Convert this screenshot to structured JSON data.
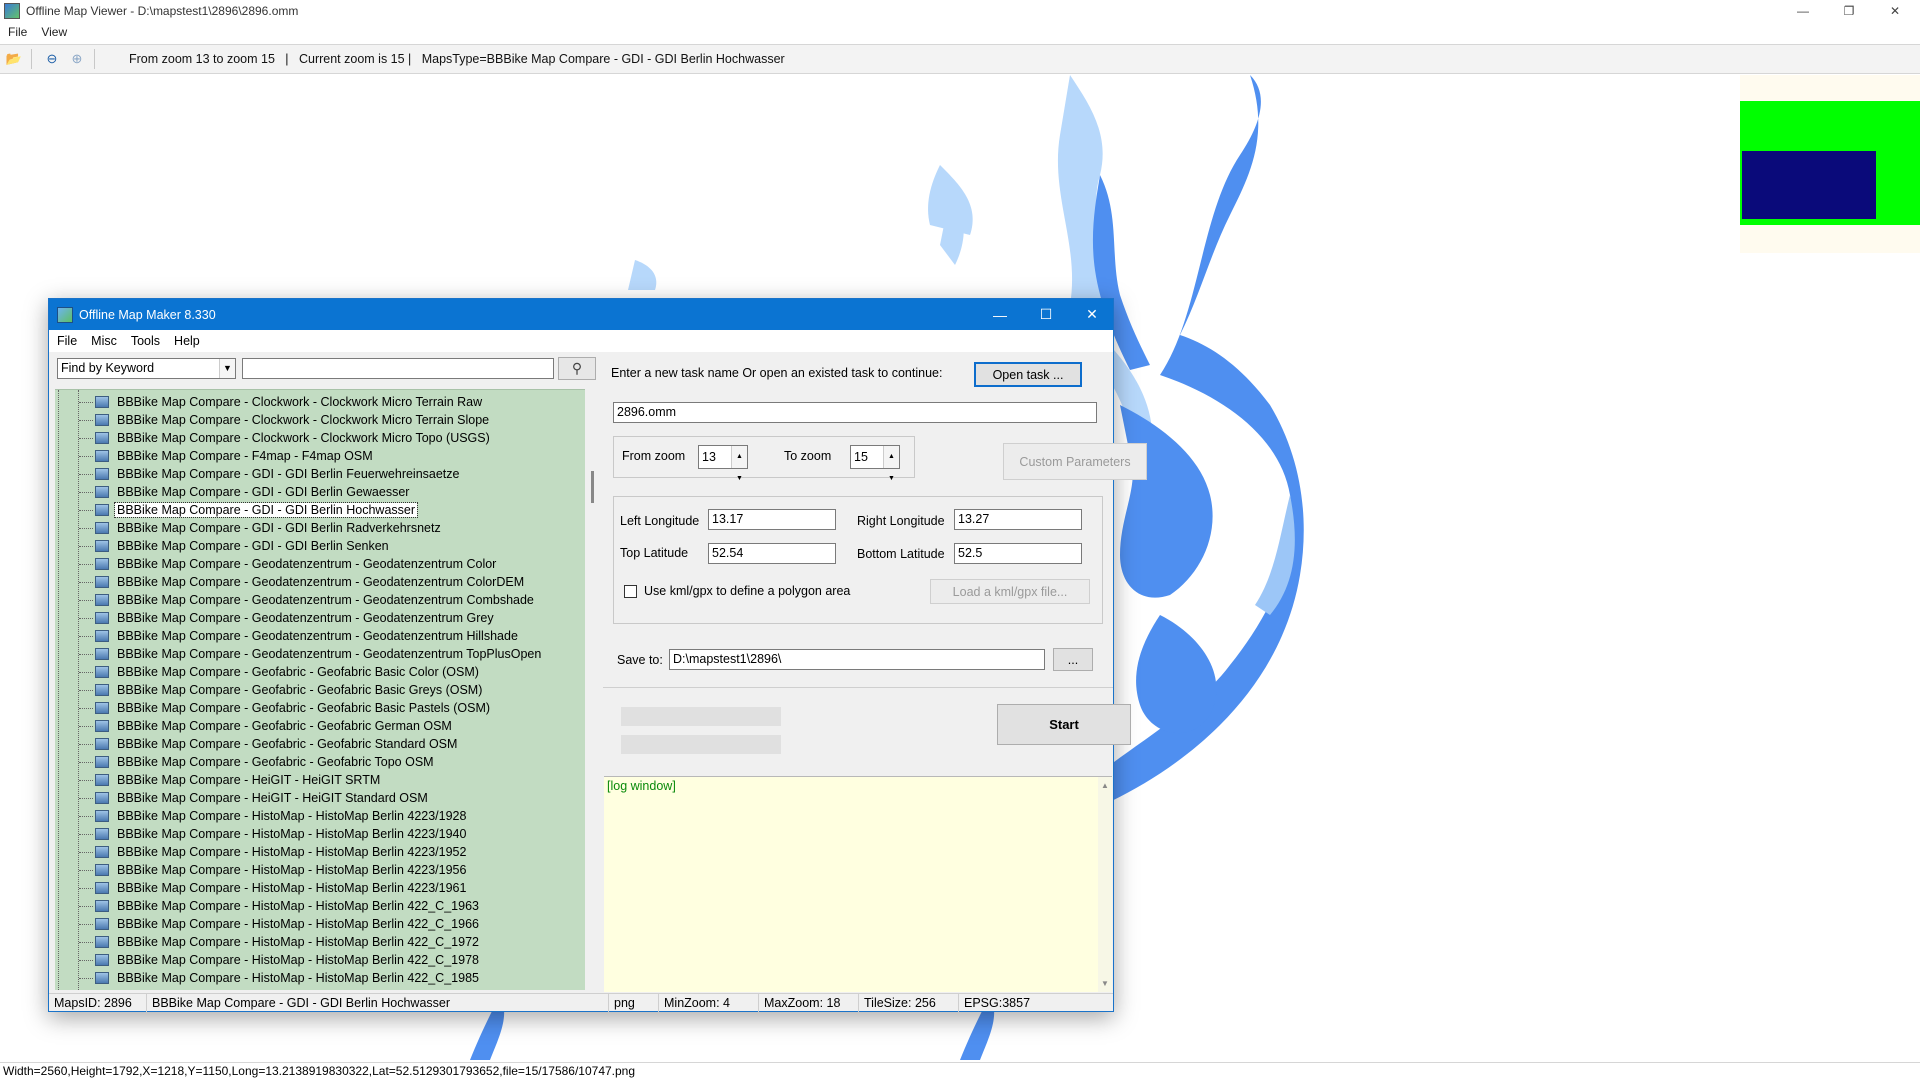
{
  "viewer": {
    "title": "Offline Map Viewer - D:\\mapstest1\\2896\\2896.omm",
    "menu": [
      "File",
      "View"
    ],
    "toolbar_info": "From zoom 13 to zoom 15   |   Current zoom is 15 |   MapsType=BBBike Map Compare - GDI - GDI Berlin Hochwasser",
    "status": "Width=2560,Height=1792,X=1218,Y=1150,Long=13.2138919830322,Lat=52.5129301793652,file=15/17586/10747.png",
    "map_color_water": "#4f8ff0",
    "map_color_light": "#b7d8fb"
  },
  "maker": {
    "title": "Offline Map Maker 8.330",
    "menu": [
      "File",
      "Misc",
      "Tools",
      "Help"
    ],
    "find_mode": "Find by Keyword",
    "find_value": "",
    "tree_items": [
      "BBBike Map Compare - Clockwork - Clockwork Micro Terrain Raw",
      "BBBike Map Compare - Clockwork - Clockwork Micro Terrain Slope",
      "BBBike Map Compare - Clockwork - Clockwork Micro Topo (USGS)",
      "BBBike Map Compare - F4map - F4map OSM",
      "BBBike Map Compare - GDI - GDI Berlin Feuerwehreinsaetze",
      "BBBike Map Compare - GDI - GDI Berlin Gewaesser",
      "BBBike Map Compare - GDI - GDI Berlin Hochwasser",
      "BBBike Map Compare - GDI - GDI Berlin Radverkehrsnetz",
      "BBBike Map Compare - GDI - GDI Berlin Senken",
      "BBBike Map Compare - Geodatenzentrum - Geodatenzentrum Color",
      "BBBike Map Compare - Geodatenzentrum - Geodatenzentrum ColorDEM",
      "BBBike Map Compare - Geodatenzentrum - Geodatenzentrum Combshade",
      "BBBike Map Compare - Geodatenzentrum - Geodatenzentrum Grey",
      "BBBike Map Compare - Geodatenzentrum - Geodatenzentrum Hillshade",
      "BBBike Map Compare - Geodatenzentrum - Geodatenzentrum TopPlusOpen",
      "BBBike Map Compare - Geofabric - Geofabric Basic Color (OSM)",
      "BBBike Map Compare - Geofabric - Geofabric Basic Greys (OSM)",
      "BBBike Map Compare - Geofabric - Geofabric Basic Pastels (OSM)",
      "BBBike Map Compare - Geofabric - Geofabric German OSM",
      "BBBike Map Compare - Geofabric - Geofabric Standard OSM",
      "BBBike Map Compare - Geofabric - Geofabric Topo OSM",
      "BBBike Map Compare - HeiGIT - HeiGIT SRTM",
      "BBBike Map Compare - HeiGIT - HeiGIT Standard OSM",
      "BBBike Map Compare - HistoMap - HistoMap Berlin 4223/1928",
      "BBBike Map Compare - HistoMap - HistoMap Berlin 4223/1940",
      "BBBike Map Compare - HistoMap - HistoMap Berlin 4223/1952",
      "BBBike Map Compare - HistoMap - HistoMap Berlin 4223/1956",
      "BBBike Map Compare - HistoMap - HistoMap Berlin 4223/1961",
      "BBBike Map Compare - HistoMap - HistoMap Berlin 422_C_1963",
      "BBBike Map Compare - HistoMap - HistoMap Berlin 422_C_1966",
      "BBBike Map Compare - HistoMap - HistoMap Berlin 422_C_1972",
      "BBBike Map Compare - HistoMap - HistoMap Berlin 422_C_1978",
      "BBBike Map Compare - HistoMap - HistoMap Berlin 422_C_1985"
    ],
    "selected_index": 6,
    "task_prompt": "Enter a new task name Or open an existed task to continue:",
    "open_task_label": "Open task ...",
    "task_name": "2896.omm",
    "from_zoom_label": "From zoom",
    "from_zoom": "13",
    "to_zoom_label": "To zoom",
    "to_zoom": "15",
    "custom_params_label": "Custom Parameters",
    "left_lon_label": "Left Longitude",
    "left_lon": "13.17",
    "right_lon_label": "Right Longitude",
    "right_lon": "13.27",
    "top_lat_label": "Top Latitude",
    "top_lat": "52.54",
    "bottom_lat_label": "Bottom Latitude",
    "bottom_lat": "52.5",
    "kml_label": "Use kml/gpx to define a polygon area",
    "load_kml_label": "Load a kml/gpx file...",
    "save_to_label": "Save to:",
    "save_to": "D:\\mapstest1\\2896\\",
    "browse_label": "...",
    "start_label": "Start",
    "log_text": "[log window]",
    "status": {
      "maps_id": "MapsID: 2896",
      "map_name": "BBBike Map Compare - GDI - GDI Berlin Hochwasser",
      "format": "png",
      "min_zoom": "MinZoom: 4",
      "max_zoom": "MaxZoom: 18",
      "tile_size": "TileSize: 256",
      "epsg": "EPSG:3857"
    }
  }
}
